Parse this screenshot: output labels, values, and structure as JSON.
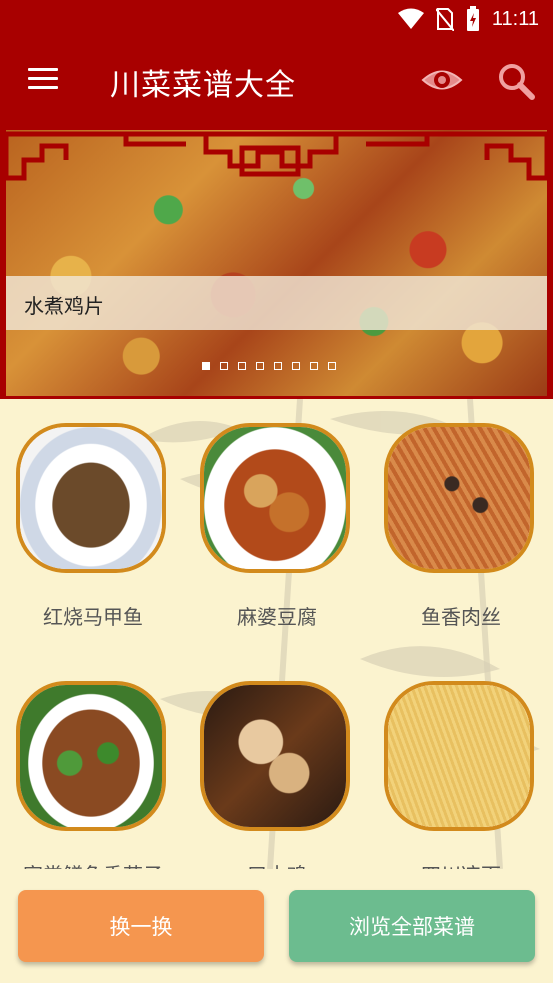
{
  "status_bar": {
    "time": "11:11",
    "icons": [
      "wifi-icon",
      "no-sim-icon",
      "battery-charging-icon"
    ]
  },
  "app_bar": {
    "title": "川菜菜谱大全",
    "menu_icon": "hamburger-menu-icon",
    "view_icon": "eye-icon",
    "search_icon": "search-icon",
    "color": "#a80000"
  },
  "banner": {
    "caption": "水煮鸡片",
    "page_count": 8,
    "active_page": 1
  },
  "dishes": [
    {
      "name": "红烧马甲鱼"
    },
    {
      "name": "麻婆豆腐"
    },
    {
      "name": "鱼香肉丝"
    },
    {
      "name": "家常鳝鱼香菇子"
    },
    {
      "name": "口水鸡"
    },
    {
      "name": "四川凉面"
    }
  ],
  "buttons": {
    "shuffle": "换一换",
    "browse_all": "浏览全部菜谱",
    "shuffle_color": "#f5964f",
    "browse_color": "#6cbc8f"
  }
}
